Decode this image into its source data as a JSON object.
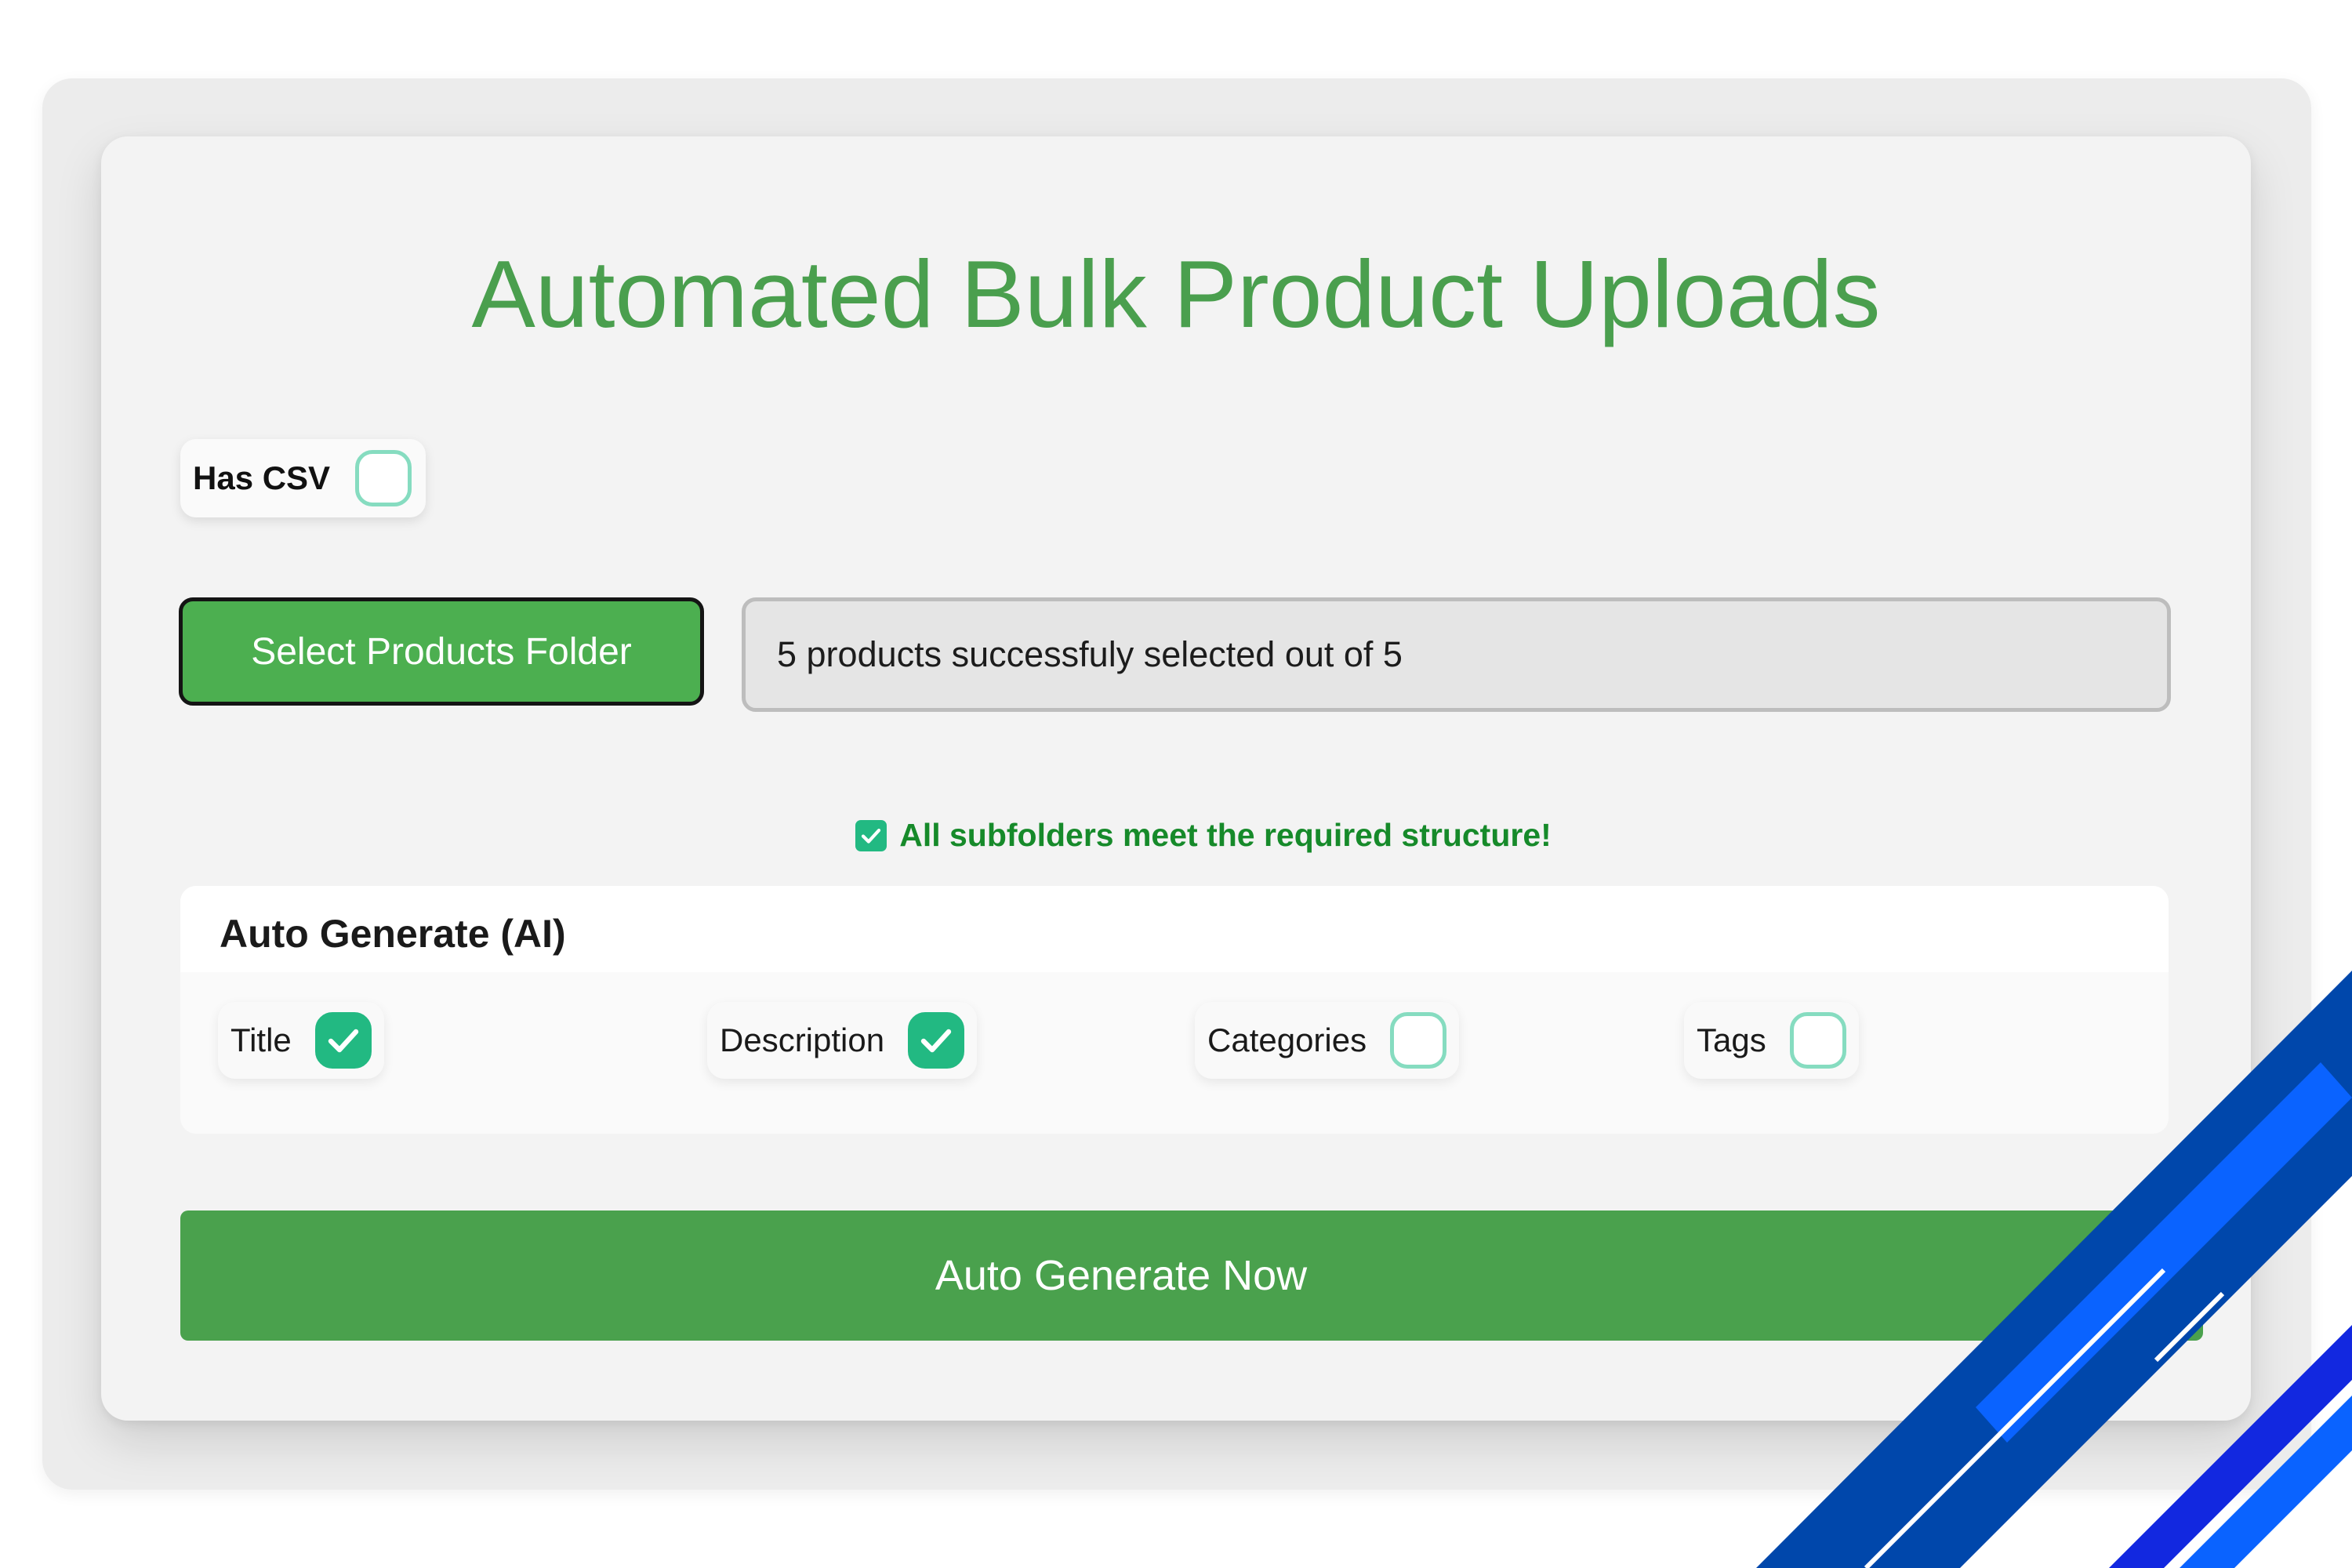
{
  "page": {
    "title": "Automated Bulk Product Uploads"
  },
  "csv_toggle": {
    "label": "Has CSV",
    "checked": false
  },
  "folder_select": {
    "button_label": "Select Products Folder",
    "status_text": "5 products successfuly selected out of 5"
  },
  "validation": {
    "message": "All subfolders meet the required structure!",
    "icon": "check-square-icon",
    "color": "#168a2a"
  },
  "auto_generate": {
    "heading": "Auto Generate (AI)",
    "options": [
      {
        "label": "Title",
        "checked": true
      },
      {
        "label": "Description",
        "checked": true
      },
      {
        "label": "Categories",
        "checked": false
      },
      {
        "label": "Tags",
        "checked": false
      }
    ],
    "submit_label": "Auto Generate Now"
  },
  "colors": {
    "accent_green": "#4caf50",
    "title_green": "#4a9f4e",
    "checkbox_green": "#22b982",
    "checkbox_outline": "#86dcc0",
    "decor_blue_dark": "#0047ab",
    "decor_blue_light": "#0a63ff"
  }
}
